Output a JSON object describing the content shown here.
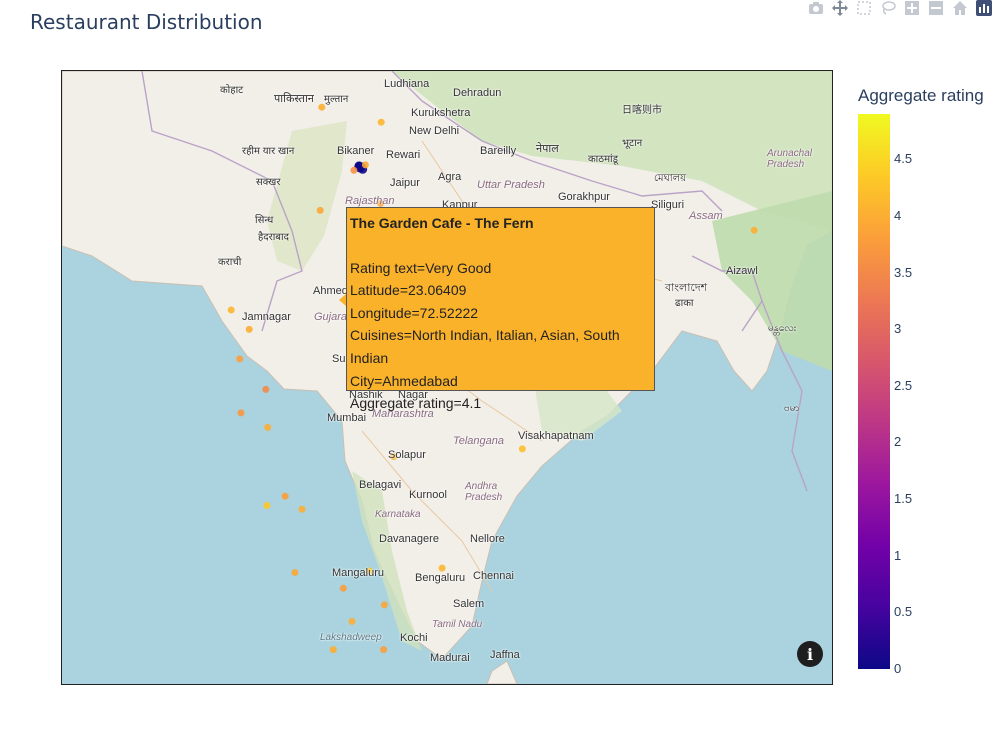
{
  "page": {
    "title": "Restaurant Distribution"
  },
  "modebar": [
    "camera-icon",
    "pan-icon",
    "box-select-icon",
    "lasso-icon",
    "zoom-in-icon",
    "zoom-out-icon",
    "home-icon",
    "plotly-logo-icon"
  ],
  "map": {
    "labels": [
      {
        "text": "Ludhiana"
      },
      {
        "text": "Dehradun"
      },
      {
        "text": "Kurukshetra"
      },
      {
        "text": "New Delhi"
      },
      {
        "text": "Bikaner"
      },
      {
        "text": "Rewari"
      },
      {
        "text": "Bareilly"
      },
      {
        "text": "Agra"
      },
      {
        "text": "Jaipur"
      },
      {
        "text": "Uttar Pradesh"
      },
      {
        "text": "Gorakhpur"
      },
      {
        "text": "Rajasthan"
      },
      {
        "text": "Kanpur"
      },
      {
        "text": "Siliguri"
      },
      {
        "text": "Assam"
      },
      {
        "text": "Aizawl"
      },
      {
        "text": "Arunachal Pradesh"
      },
      {
        "text": "Ahmedabad"
      },
      {
        "text": "Jamnagar"
      },
      {
        "text": "Gujarat"
      },
      {
        "text": "Surat"
      },
      {
        "text": "Nashik"
      },
      {
        "text": "Nagar"
      },
      {
        "text": "Mumbai"
      },
      {
        "text": "Maharashtra"
      },
      {
        "text": "Telangana"
      },
      {
        "text": "Visakhapatnam"
      },
      {
        "text": "Solapur"
      },
      {
        "text": "Belagavi"
      },
      {
        "text": "Kurnool"
      },
      {
        "text": "Andhra Pradesh"
      },
      {
        "text": "Karnataka"
      },
      {
        "text": "Davanagere"
      },
      {
        "text": "Nellore"
      },
      {
        "text": "Mangaluru"
      },
      {
        "text": "Bengaluru"
      },
      {
        "text": "Chennai"
      },
      {
        "text": "Salem"
      },
      {
        "text": "Tamil Nadu"
      },
      {
        "text": "Lakshadweep"
      },
      {
        "text": "Kochi"
      },
      {
        "text": "Madurai"
      },
      {
        "text": "Jaffna"
      },
      {
        "text": "कोहाट"
      },
      {
        "text": "पाकिस्तान"
      },
      {
        "text": "मुल्तान"
      },
      {
        "text": "रहीम यार खान"
      },
      {
        "text": "सक्खर"
      },
      {
        "text": "सिन्ध"
      },
      {
        "text": "हैदराबाद"
      },
      {
        "text": "कराची"
      },
      {
        "text": "नेपाल"
      },
      {
        "text": "काठमांडू"
      },
      {
        "text": "भूटान"
      },
      {
        "text": "বাংলাদেশ"
      },
      {
        "text": "ढाका"
      },
      {
        "text": "日喀则市"
      },
      {
        "text": "মেঘালয়"
      },
      {
        "text": "ဗမာ"
      },
      {
        "text": "မန္တလေး"
      }
    ],
    "points": [
      {
        "lat": 30.9,
        "lon": 75.85,
        "rating": 4.0
      },
      {
        "lat": 30.32,
        "lon": 78.03,
        "rating": 4.1
      },
      {
        "lat": 28.61,
        "lon": 77.21,
        "rating": 0.0
      },
      {
        "lat": 28.63,
        "lon": 77.22,
        "rating": 0.0
      },
      {
        "lat": 28.6,
        "lon": 77.3,
        "rating": 0.0
      },
      {
        "lat": 28.55,
        "lon": 77.25,
        "rating": 0.0
      },
      {
        "lat": 28.46,
        "lon": 77.03,
        "rating": 3.6
      },
      {
        "lat": 28.5,
        "lon": 77.35,
        "rating": 0.0
      },
      {
        "lat": 28.67,
        "lon": 77.45,
        "rating": 3.9
      },
      {
        "lat": 27.18,
        "lon": 78.01,
        "rating": 3.9
      },
      {
        "lat": 26.91,
        "lon": 75.79,
        "rating": 3.9
      },
      {
        "lat": 26.45,
        "lon": 80.35,
        "rating": 3.8
      },
      {
        "lat": 26.85,
        "lon": 80.95,
        "rating": 3.9
      },
      {
        "lat": 26.76,
        "lon": 83.37,
        "rating": 4.0
      },
      {
        "lat": 26.14,
        "lon": 91.74,
        "rating": 4.0
      },
      {
        "lat": 23.06,
        "lon": 72.52,
        "rating": 4.1
      },
      {
        "lat": 22.31,
        "lon": 73.18,
        "rating": 4.0
      },
      {
        "lat": 21.17,
        "lon": 72.83,
        "rating": 3.8
      },
      {
        "lat": 19.99,
        "lon": 73.79,
        "rating": 3.5
      },
      {
        "lat": 19.08,
        "lon": 72.88,
        "rating": 3.7
      },
      {
        "lat": 18.52,
        "lon": 73.86,
        "rating": 4.0
      },
      {
        "lat": 17.39,
        "lon": 78.49,
        "rating": 4.1
      },
      {
        "lat": 17.69,
        "lon": 83.22,
        "rating": 4.2
      },
      {
        "lat": 15.86,
        "lon": 74.5,
        "rating": 3.8
      },
      {
        "lat": 15.5,
        "lon": 73.83,
        "rating": 4.3
      },
      {
        "lat": 15.36,
        "lon": 75.12,
        "rating": 4.0
      },
      {
        "lat": 12.91,
        "lon": 74.86,
        "rating": 3.9
      },
      {
        "lat": 12.97,
        "lon": 77.59,
        "rating": 4.3
      },
      {
        "lat": 13.08,
        "lon": 80.27,
        "rating": 4.1
      },
      {
        "lat": 12.3,
        "lon": 76.64,
        "rating": 3.8
      },
      {
        "lat": 11.66,
        "lon": 78.15,
        "rating": 3.9
      },
      {
        "lat": 11.02,
        "lon": 76.96,
        "rating": 4.0
      },
      {
        "lat": 9.93,
        "lon": 76.27,
        "rating": 4.0
      },
      {
        "lat": 9.93,
        "lon": 78.12,
        "rating": 3.8
      }
    ]
  },
  "tooltip": {
    "name": "The Garden Cafe - The Fern",
    "lines": [
      "Rating text=Very Good",
      "Latitude=23.06409",
      "Longitude=72.52222",
      "Cuisines=North Indian, Italian, Asian, South Indian",
      "City=Ahmedabad",
      "Aggregate rating=4.1"
    ],
    "color": "#fbb22b"
  },
  "info_button": "i",
  "colorbar": {
    "title": "Aggregate rating",
    "ticks": [
      "4.5",
      "4",
      "3.5",
      "3",
      "2.5",
      "2",
      "1.5",
      "1",
      "0.5",
      "0"
    ],
    "tick_values": [
      4.5,
      4,
      3.5,
      3,
      2.5,
      2,
      1.5,
      1,
      0.5,
      0
    ],
    "range": [
      0,
      4.9
    ],
    "colorscale": [
      "#0d0887",
      "#46039f",
      "#7201a8",
      "#9c179e",
      "#bd3786",
      "#d8576b",
      "#ed7953",
      "#fb9f3a",
      "#fdca26",
      "#f0f921"
    ]
  }
}
